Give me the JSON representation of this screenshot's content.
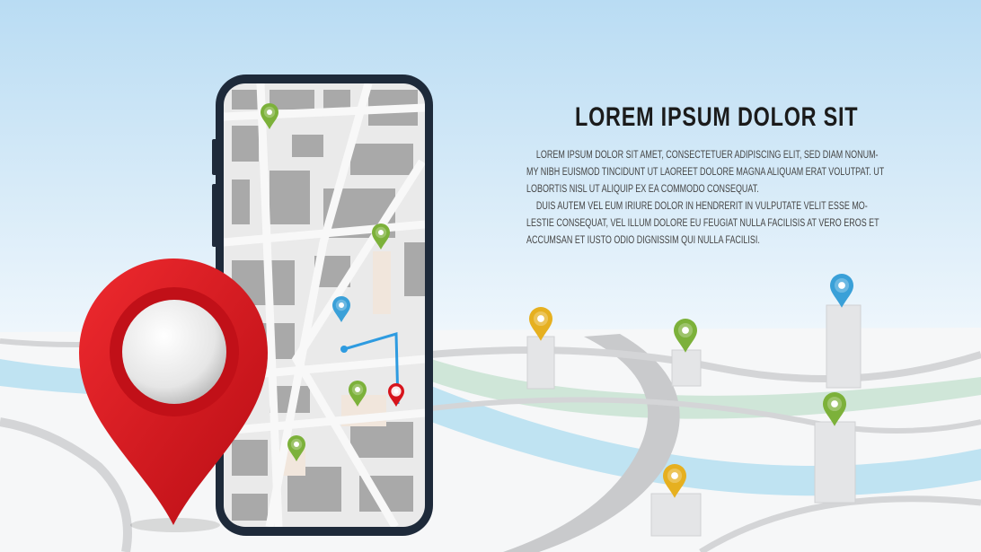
{
  "heading": "LOREM IPSUM DOLOR SIT",
  "paragraph_lines": [
    "LOREM IPSUM DOLOR SIT AMET, CONSECTETUER ADIPISCING ELIT, SED DIAM NONUM-",
    "MY NIBH EUISMOD TINCIDUNT UT LAOREET DOLORE MAGNA ALIQUAM ERAT VOLUTPAT. UT",
    "LOBORTIS NISL UT ALIQUIP EX EA COMMODO CONSEQUAT.",
    "DUIS AUTEM VEL EUM IRIURE DOLOR IN HENDRERIT IN VULPUTATE VELIT ESSE MO-",
    "LESTIE CONSEQUAT, VEL ILLUM DOLORE EU FEUGIAT NULLA FACILISIS AT VERO EROS ET",
    "ACCUMSAN ET IUSTO ODIO DIGNISSIM QUI NULLA FACILISI."
  ],
  "colors": {
    "pin_red": "#d7141c",
    "pin_green": "#7cb13a",
    "pin_yellow": "#e6b020",
    "pin_blue": "#3aa0d8",
    "phone": "#1e2a3a",
    "map": "#c9c9c9",
    "water": "#bfe3f2",
    "park": "#cfe6d8"
  },
  "icons": [
    "location-pin-icon",
    "cup-icon",
    "home-icon",
    "fork-knife-icon"
  ]
}
